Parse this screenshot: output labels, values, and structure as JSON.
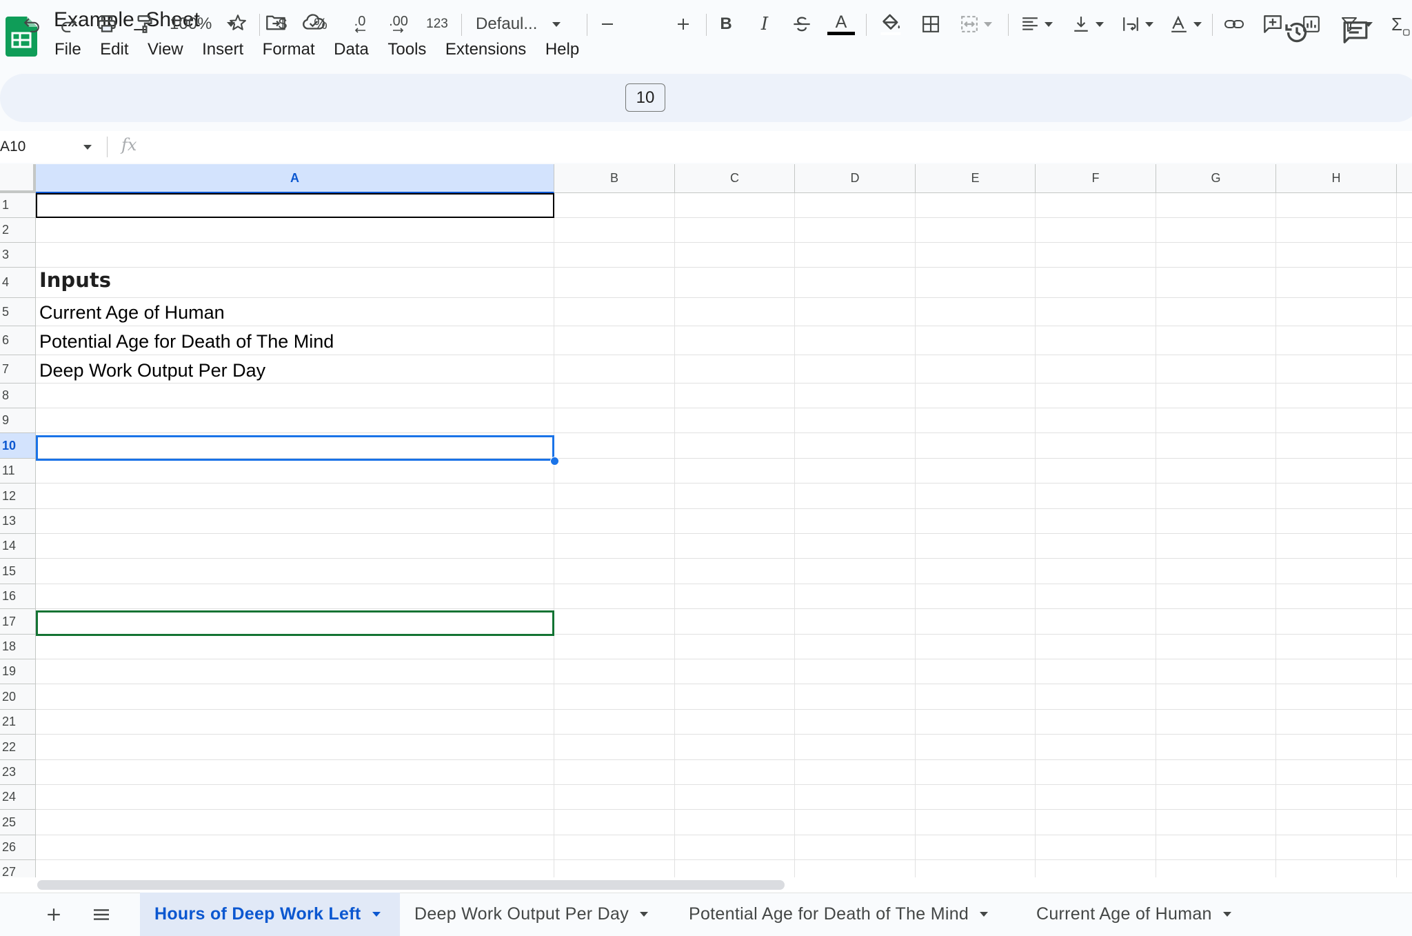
{
  "document": {
    "title": "Example_Sheet"
  },
  "menu": [
    "File",
    "Edit",
    "View",
    "Insert",
    "Format",
    "Data",
    "Tools",
    "Extensions",
    "Help"
  ],
  "toolbar": {
    "zoom": "100%",
    "currency_label": "$",
    "percent_label": "%",
    "decrease_decimals_label": ".0",
    "increase_decimals_label": ".00",
    "number_format_label": "123",
    "font_family": "Defaul...",
    "font_size": "10",
    "text_color": "#000000"
  },
  "formula_bar": {
    "name_box": "A10",
    "fx_label": "fx",
    "content": ""
  },
  "grid": {
    "columns": [
      "A",
      "B",
      "C",
      "D",
      "E",
      "F",
      "G",
      "H"
    ],
    "selected_column": "A",
    "rows": [
      "1",
      "2",
      "3",
      "4",
      "5",
      "6",
      "7",
      "8",
      "9",
      "10",
      "11",
      "12",
      "13",
      "14",
      "15",
      "16",
      "17",
      "18",
      "19",
      "20",
      "21",
      "22",
      "23",
      "24",
      "25",
      "26",
      "27"
    ],
    "selected_row": "10",
    "cells": {
      "A4": "Inputs",
      "A5": "Current Age of Human",
      "A6": "Potential Age for Death of The Mind",
      "A7": "Deep Work Output Per Day"
    },
    "active_cell": "A10"
  },
  "sheet_tabs": [
    {
      "label": "Hours of Deep Work Left",
      "active": true
    },
    {
      "label": "Deep Work Output Per Day",
      "active": false
    },
    {
      "label": "Potential Age for Death of The Mind",
      "active": false
    },
    {
      "label": "Current Age of Human",
      "active": false
    }
  ],
  "colors": {
    "accent": "#0b57d0",
    "brand_green": "#0f9d58",
    "selection_header": "#d3e3fd",
    "highlight_green": "#137333"
  }
}
